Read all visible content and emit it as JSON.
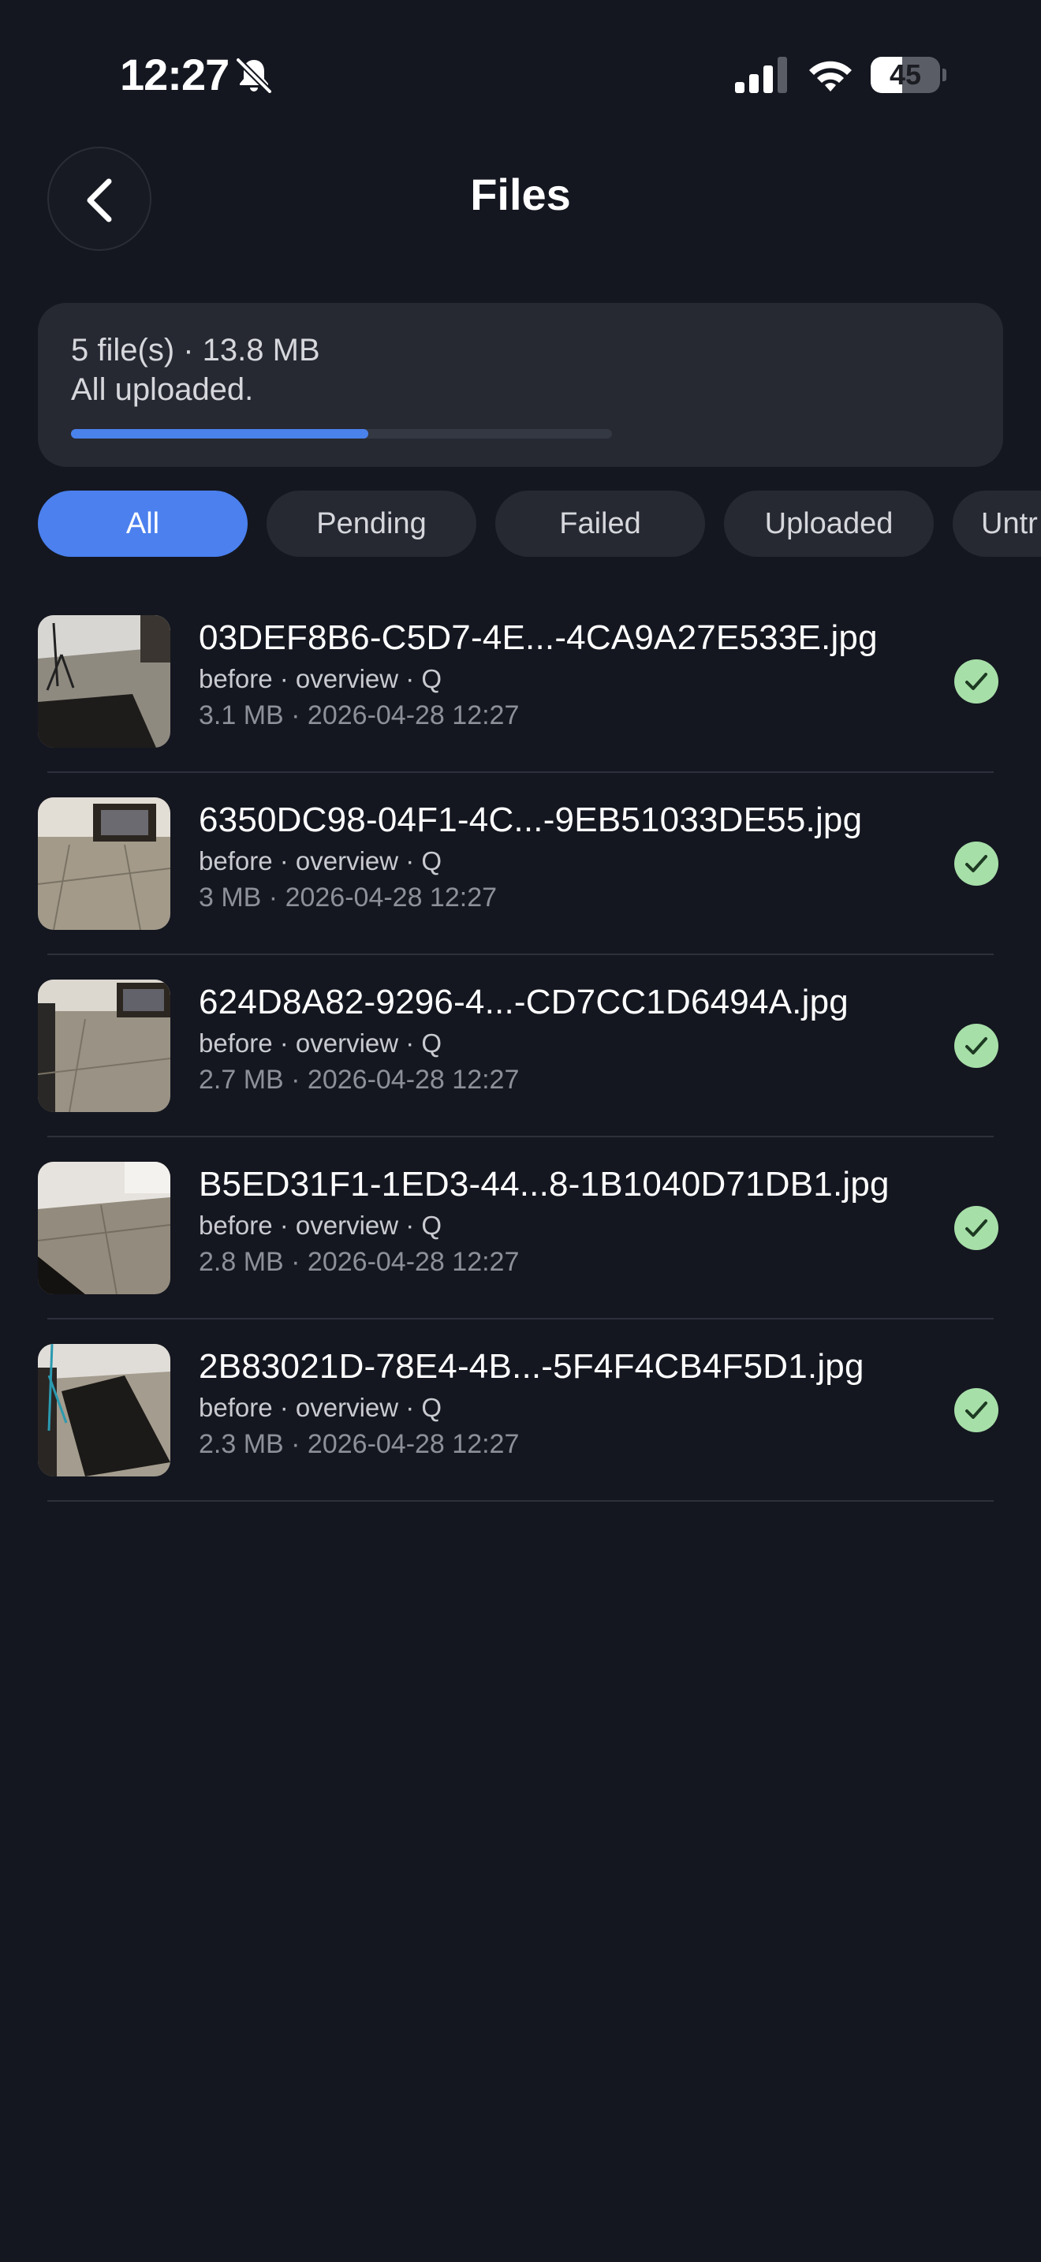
{
  "status_bar": {
    "time": "12:27",
    "battery_level": "45",
    "battery_fraction": 0.45,
    "icons": [
      "bell-slash-icon",
      "cellular-signal-icon",
      "wifi-icon",
      "battery-icon"
    ]
  },
  "header": {
    "title": "Files",
    "back_icon": "chevron-left-icon"
  },
  "summary": {
    "line1": "5 file(s) · 13.8 MB",
    "line2": "All uploaded.",
    "progress_fraction": 0.55
  },
  "filters": {
    "chips": [
      {
        "label": "All",
        "active": true
      },
      {
        "label": "Pending",
        "active": false
      },
      {
        "label": "Failed",
        "active": false
      },
      {
        "label": "Uploaded",
        "active": false
      },
      {
        "label": "Untr",
        "active": false
      }
    ]
  },
  "files": [
    {
      "name": "03DEF8B6-C5D7-4E...-4CA9A27E533E.jpg",
      "tags": "before · overview · Q",
      "meta": "3.1 MB · 2026-04-28 12:27",
      "status_icon": "check-circle-icon"
    },
    {
      "name": "6350DC98-04F1-4C...-9EB51033DE55.jpg",
      "tags": "before · overview · Q",
      "meta": "3 MB · 2026-04-28 12:27",
      "status_icon": "check-circle-icon"
    },
    {
      "name": "624D8A82-9296-4...-CD7CC1D6494A.jpg",
      "tags": "before · overview · Q",
      "meta": "2.7 MB · 2026-04-28 12:27",
      "status_icon": "check-circle-icon"
    },
    {
      "name": "B5ED31F1-1ED3-44...8-1B1040D71DB1.jpg",
      "tags": "before · overview · Q",
      "meta": "2.8 MB · 2026-04-28 12:27",
      "status_icon": "check-circle-icon"
    },
    {
      "name": "2B83021D-78E4-4B...-5F4F4CB4F5D1.jpg",
      "tags": "before · overview · Q",
      "meta": "2.3 MB · 2026-04-28 12:27",
      "status_icon": "check-circle-icon"
    }
  ],
  "colors": {
    "background": "#141720",
    "card": "#262932",
    "accent": "#4b80ee",
    "success": "#a7dfa8"
  }
}
